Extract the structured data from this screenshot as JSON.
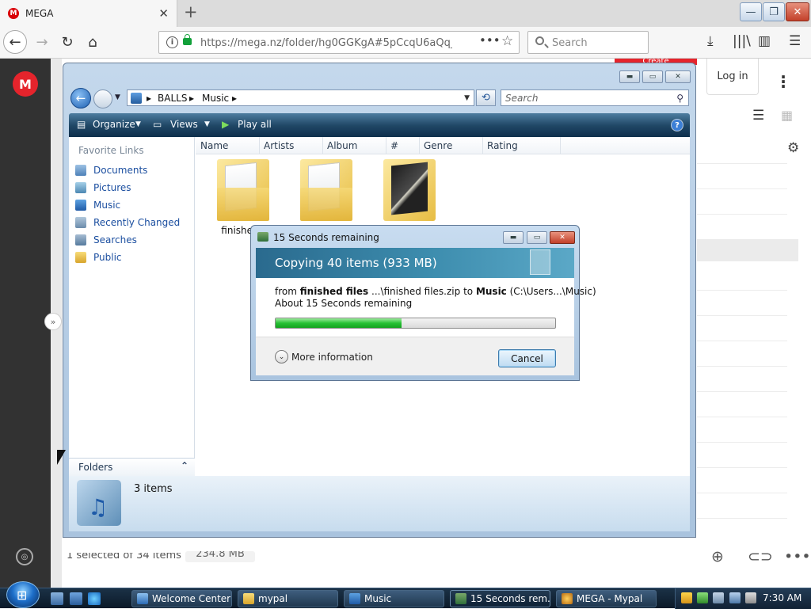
{
  "browser": {
    "tab_title": "MEGA",
    "url": "https://mega.nz/folder/hg0GGKgA#5pCcqU6aQq_",
    "search_placeholder": "Search",
    "icons": [
      "back-icon",
      "forward-icon",
      "reload-icon",
      "home-icon",
      "info-icon",
      "lock-icon",
      "page-actions-icon",
      "bookmark-star-icon",
      "search-icon",
      "download-icon",
      "library-icon",
      "sidebar-icon",
      "menu-icon"
    ]
  },
  "mega": {
    "create_label": "Create",
    "login_label": "Log in",
    "status_selected": "1 selected of 34 items",
    "status_size": "234.8 MB",
    "accent": "#e5242c",
    "logo_letter": "M"
  },
  "explorer": {
    "breadcrumb": [
      "BALLS",
      "Music"
    ],
    "search_placeholder": "Search",
    "commands": {
      "organize": "Organize",
      "views": "Views",
      "play_all": "Play all"
    },
    "favorite_links_heading": "Favorite Links",
    "favorite_links": [
      "Documents",
      "Pictures",
      "Music",
      "Recently Changed",
      "Searches",
      "Public"
    ],
    "columns": [
      "Name",
      "Artists",
      "Album",
      "#",
      "Genre",
      "Rating"
    ],
    "items": [
      {
        "label": "finished f"
      },
      {
        "label": ""
      },
      {
        "label": ""
      }
    ],
    "folders_label": "Folders",
    "details_count": "3 items"
  },
  "copy_dialog": {
    "title": "15 Seconds remaining",
    "heading": "Copying 40 items (933 MB)",
    "from_prefix": "from ",
    "from_name": "finished files",
    "from_path": " ...\\finished files.zip  to ",
    "to_name": "Music",
    "to_path": " (C:\\Users...\\Music)",
    "eta": "About 15 Seconds remaining",
    "progress": 0.45,
    "more_info": "More information",
    "cancel_label": "Cancel"
  },
  "taskbar": {
    "buttons": [
      "Welcome Center",
      "mypal",
      "Music",
      "15 Seconds rem...",
      "MEGA - Mypal"
    ],
    "clock": "7:30 AM"
  }
}
